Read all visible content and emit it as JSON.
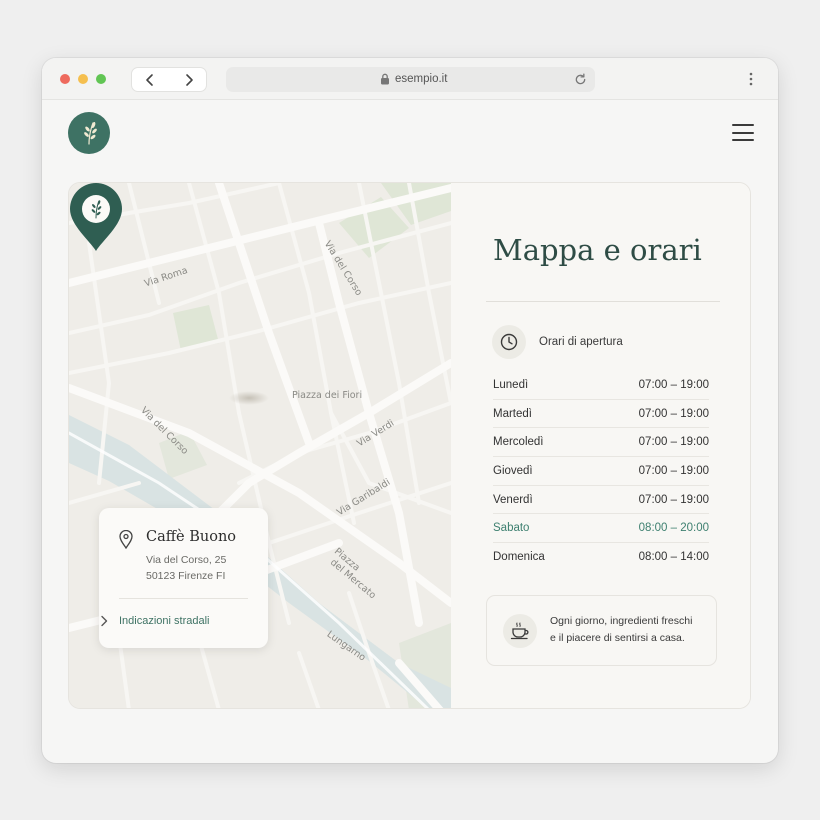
{
  "browser": {
    "url": "esempio.it",
    "icons": {
      "back": "chevron-left-icon",
      "forward": "chevron-right-icon",
      "lock": "lock-icon",
      "reload": "reload-icon",
      "menu": "kebab-menu-icon"
    }
  },
  "header": {
    "logo_icon": "olive-branch-icon",
    "menu_icon": "hamburger-menu-icon"
  },
  "map": {
    "labels": {
      "via_roma": "Via Roma",
      "via_del_corso_top": "Via del Corso",
      "piazza_fiori": "Piazza dei Fiori",
      "via_del_corso_left": "Via del Corso",
      "via_verdi": "Via Verdi",
      "via_garibaldi": "Via Garibaldi",
      "piazza_mercato_1": "Piazza",
      "piazza_mercato_2": "del Mercato",
      "lungarno": "Lungarno"
    },
    "place": {
      "name": "Caffè Buono",
      "street": "Via del Corso, 25",
      "city": "50123 Firenze FI",
      "directions": "Indicazioni stradali"
    }
  },
  "panel": {
    "title": "Mappa e orari",
    "hours_title": "Orari di apertura",
    "hours": [
      {
        "day": "Lunedì",
        "time": "07:00 – 19:00"
      },
      {
        "day": "Martedì",
        "time": "07:00 – 19:00"
      },
      {
        "day": "Mercoledì",
        "time": "07:00 – 19:00"
      },
      {
        "day": "Giovedì",
        "time": "07:00 – 19:00"
      },
      {
        "day": "Venerdì",
        "time": "07:00 – 19:00"
      },
      {
        "day": "Sabato",
        "time": "08:00 – 20:00"
      },
      {
        "day": "Domenica",
        "time": "08:00 – 14:00"
      }
    ],
    "note_line1": "Ogni giorno, ingredienti freschi",
    "note_line2": "e il piacere di sentirsi a casa."
  },
  "colors": {
    "accent": "#3e7264",
    "highlight": "#3e8070",
    "title": "#2e4c45",
    "river": "#d9e3e3",
    "park": "#dfe6d6"
  }
}
